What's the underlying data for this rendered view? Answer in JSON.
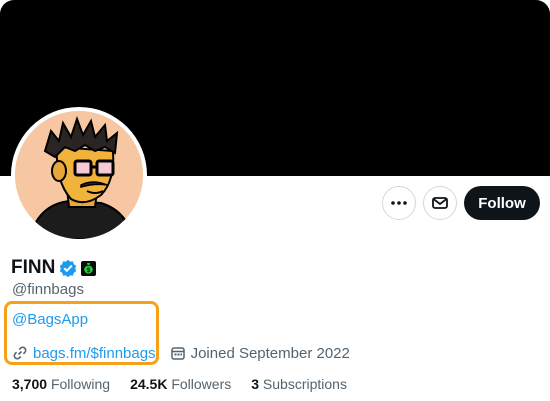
{
  "profile": {
    "display_name": "FINN",
    "handle": "@finnbags",
    "bio_mention": "@BagsApp",
    "website": "bags.fm/$finnbags",
    "joined": "Joined September 2022"
  },
  "actions": {
    "more_icon": "more-icon",
    "message_icon": "mail-icon",
    "follow_label": "Follow"
  },
  "stats": [
    {
      "value": "3,700",
      "label": "Following"
    },
    {
      "value": "24.5K",
      "label": "Followers"
    },
    {
      "value": "3",
      "label": "Subscriptions"
    }
  ],
  "colors": {
    "banner": "#000000",
    "accent_link": "#1d9bf0",
    "verified": "#1d9bf0",
    "highlight_outline": "#f7a11a",
    "follow_bg": "#0f1419",
    "avatar_bg": "#f7c7a3"
  }
}
